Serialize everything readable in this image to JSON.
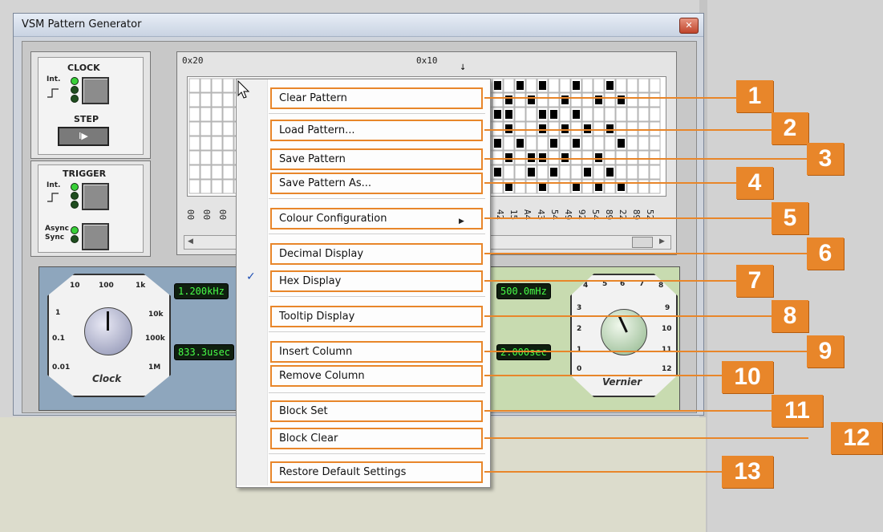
{
  "window": {
    "title": "VSM Pattern Generator",
    "close_label": "✕"
  },
  "clock_panel": {
    "title": "CLOCK",
    "int_label": "Int.",
    "step_title": "STEP",
    "step_glyph": "I▶"
  },
  "trigger_panel": {
    "title": "TRIGGER",
    "int_label": "Int.",
    "async_label": "Async",
    "sync_label": "Sync"
  },
  "grid": {
    "header_left": "0x20",
    "header_mid": "0x10",
    "row_labels_left": [
      "00",
      "00",
      "00"
    ],
    "row_labels_right": [
      "42",
      "15",
      "A4",
      "43",
      "54",
      "49",
      "92",
      "54",
      "89",
      "22",
      "89",
      "52"
    ]
  },
  "clock_dial": {
    "name": "Clock",
    "ticks": [
      "10",
      "100",
      "1k",
      "1",
      "10k",
      "0.1",
      "100k",
      "0.01",
      "1M"
    ],
    "freq_readout": "1.200kHz",
    "period_readout": "833.3usec"
  },
  "vernier_dial": {
    "name": "Vernier",
    "ticks": [
      "4",
      "5",
      "6",
      "7",
      "8",
      "3",
      "9",
      "2",
      "10",
      "1",
      "11",
      "0",
      "12"
    ],
    "freq_readout": "500.0mHz",
    "period_readout": "2.000sec"
  },
  "context_menu": {
    "items": [
      {
        "label": "Clear Pattern"
      },
      {
        "label": "Load Pattern..."
      },
      {
        "label": "Save Pattern"
      },
      {
        "label": "Save Pattern As..."
      },
      {
        "label": "Colour Configuration"
      },
      {
        "label": "Decimal Display"
      },
      {
        "label": "Hex Display",
        "checked": true
      },
      {
        "label": "Tooltip Display"
      },
      {
        "label": "Insert Column"
      },
      {
        "label": "Remove Column"
      },
      {
        "label": "Block Set"
      },
      {
        "label": "Block Clear"
      },
      {
        "label": "Restore Default Settings"
      }
    ],
    "check_glyph": "✓",
    "submenu_arrow": "▶"
  },
  "callouts": [
    "1",
    "2",
    "3",
    "4",
    "5",
    "6",
    "7",
    "8",
    "9",
    "10",
    "11",
    "12",
    "13"
  ],
  "accent_color": "#e8862a"
}
